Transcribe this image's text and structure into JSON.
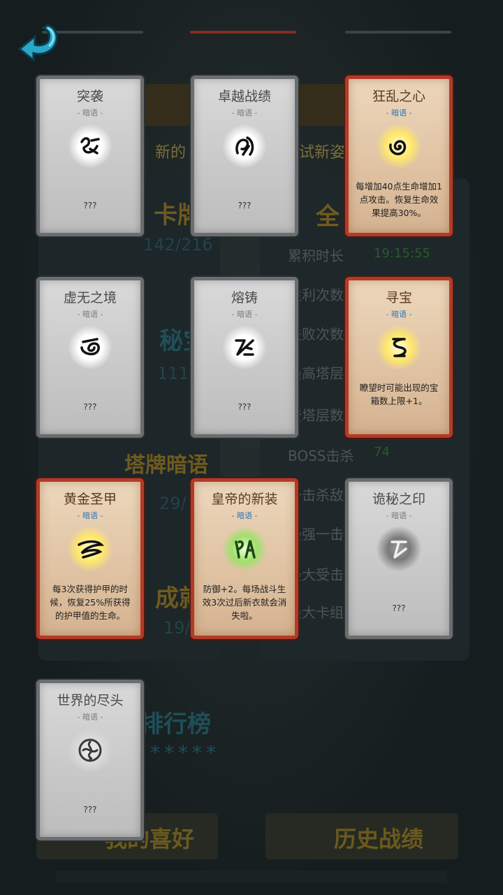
{
  "background": {
    "subtitle_left": "新的",
    "subtitle_right": "试新姿",
    "menu": [
      {
        "label": "卡牌",
        "count": "142/216"
      },
      {
        "label": "秘宝",
        "count": "111/"
      },
      {
        "label": "塔牌暗语",
        "count": "29/"
      },
      {
        "label": "成就",
        "count": "19/"
      },
      {
        "label": "排行榜",
        "count": "*****"
      }
    ],
    "stats_header": "全",
    "stats": [
      {
        "label": "累积时长",
        "value": "19:15:55"
      },
      {
        "label": "胜利次数",
        "value": ""
      },
      {
        "label": "失败次数",
        "value": ""
      },
      {
        "label": "最高塔层",
        "value": ""
      },
      {
        "label": "登塔层数",
        "value": ""
      },
      {
        "label": "BOSS击杀",
        "value": "74"
      },
      {
        "label": "一击杀敌",
        "value": ""
      },
      {
        "label": "最强一击",
        "value": ""
      },
      {
        "label": "最大受击",
        "value": ""
      },
      {
        "label": "最大卡组",
        "value": ""
      }
    ],
    "buttons": {
      "left": "我的喜好",
      "right": "历史战绩"
    }
  },
  "cards": [
    {
      "title": "突袭",
      "type": "暗语",
      "unlocked": false,
      "desc": "???",
      "icon": "raid-rune-icon"
    },
    {
      "title": "卓越战绩",
      "type": "暗语",
      "unlocked": false,
      "desc": "???",
      "icon": "excellence-rune-icon"
    },
    {
      "title": "狂乱之心",
      "type": "暗语",
      "unlocked": true,
      "desc": "每增加40点生命增加1点攻击。恢复生命效果提高30%。",
      "icon": "spiral-rune-icon"
    },
    {
      "title": "虚无之境",
      "type": "暗语",
      "unlocked": false,
      "desc": "???",
      "icon": "void-rune-icon"
    },
    {
      "title": "熔铸",
      "type": "暗语",
      "unlocked": false,
      "desc": "???",
      "icon": "forge-rune-icon"
    },
    {
      "title": "寻宝",
      "type": "暗语",
      "unlocked": true,
      "desc": "瞭望时可能出现的宝箱数上限+1。",
      "icon": "treasure-rune-icon"
    },
    {
      "title": "黄金圣甲",
      "type": "暗语",
      "unlocked": true,
      "desc": "每3次获得护甲的时候，恢复25%所获得的护甲值的生命。",
      "icon": "golden-armor-rune-icon"
    },
    {
      "title": "皇帝的新装",
      "type": "暗语",
      "unlocked": true,
      "desc": "防御+2。每场战斗生效3次过后新衣就会消失啦。",
      "icon": "emperor-clothes-rune-icon"
    },
    {
      "title": "诡秘之印",
      "type": "暗语",
      "unlocked": false,
      "desc": "???",
      "icon": "mystic-seal-rune-icon"
    },
    {
      "title": "世界的尽头",
      "type": "暗语",
      "unlocked": false,
      "desc": "???",
      "icon": "world-end-rune-icon"
    }
  ]
}
